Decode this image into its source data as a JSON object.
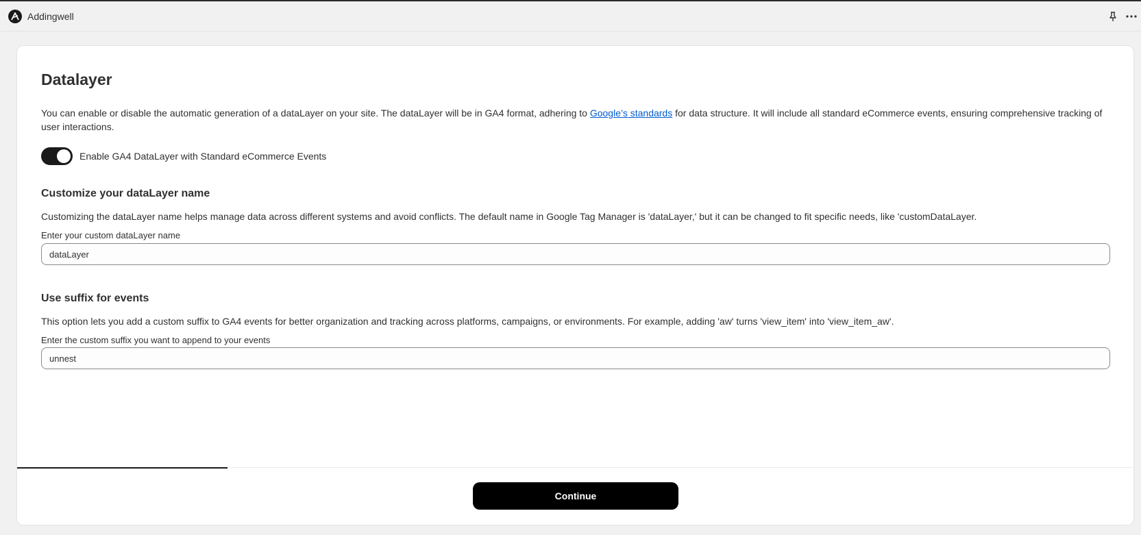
{
  "app": {
    "name": "Addingwell",
    "logo_icon": "addingwell-logo-icon",
    "pin_icon": "pin-icon",
    "more_icon": "more-horizontal-icon"
  },
  "page": {
    "title": "Datalayer",
    "intro_before_link": "You can enable or disable the automatic generation of a dataLayer on your site. The dataLayer will be in GA4 format, adhering to ",
    "intro_link": "Google’s standards",
    "intro_after_link": " for data structure. It will include all standard eCommerce events, ensuring comprehensive tracking of user interactions."
  },
  "toggle": {
    "label": "Enable GA4 DataLayer with Standard eCommerce Events",
    "checked": true
  },
  "custom_name": {
    "title": "Customize your dataLayer name",
    "description": "Customizing the dataLayer name helps manage data across different systems and avoid conflicts. The default name in Google Tag Manager is 'dataLayer,' but it can be changed to fit specific needs, like 'customDataLayer.",
    "field_label": "Enter your custom dataLayer name",
    "value": "dataLayer"
  },
  "suffix": {
    "title": "Use suffix for events",
    "description": "This option lets you add a custom suffix to GA4 events for better organization and tracking across platforms, campaigns, or environments. For example, adding 'aw' turns 'view_item' into 'view_item_aw'.",
    "field_label": "Enter the custom suffix you want to append to your events",
    "value": "unnest"
  },
  "footer": {
    "continue_label": "Continue",
    "progress_fraction": 0.188
  },
  "colors": {
    "accent": "#1a1a1a",
    "link": "#005bd3",
    "background": "#f1f1f1",
    "card": "#ffffff"
  }
}
